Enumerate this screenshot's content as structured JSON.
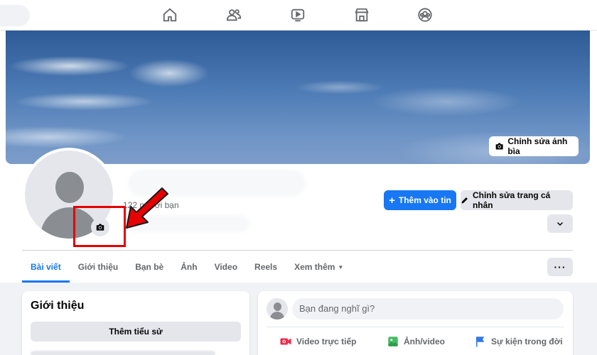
{
  "nav": {
    "icons": [
      "home-icon",
      "friends-icon",
      "video-icon",
      "marketplace-icon",
      "groups-icon"
    ]
  },
  "cover": {
    "edit_label": "Chỉnh sửa ảnh bìa"
  },
  "profile": {
    "friends_count": "122 người bạn"
  },
  "actions": {
    "add_story_label": "Thêm vào tin",
    "edit_profile_label": "Chỉnh sửa trang cá nhân"
  },
  "tabs": [
    {
      "label": "Bài viết",
      "active": true
    },
    {
      "label": "Giới thiệu",
      "active": false
    },
    {
      "label": "Bạn bè",
      "active": false
    },
    {
      "label": "Ảnh",
      "active": false
    },
    {
      "label": "Video",
      "active": false
    },
    {
      "label": "Reels",
      "active": false
    },
    {
      "label": "Xem thêm",
      "active": false
    }
  ],
  "more_button_label": "···",
  "intro": {
    "title": "Giới thiệu",
    "add_bio_label": "Thêm tiểu sử"
  },
  "composer": {
    "placeholder": "Bạn đang nghĩ gì?",
    "live_video_label": "Video trực tiếp",
    "photo_video_label": "Ảnh/video",
    "life_event_label": "Sự kiện trong đời"
  },
  "colors": {
    "accent": "#1877f2",
    "annotation_red": "#e60000",
    "live_red": "#f02849",
    "photo_green": "#45bd62",
    "event_blue": "#3578e5"
  }
}
